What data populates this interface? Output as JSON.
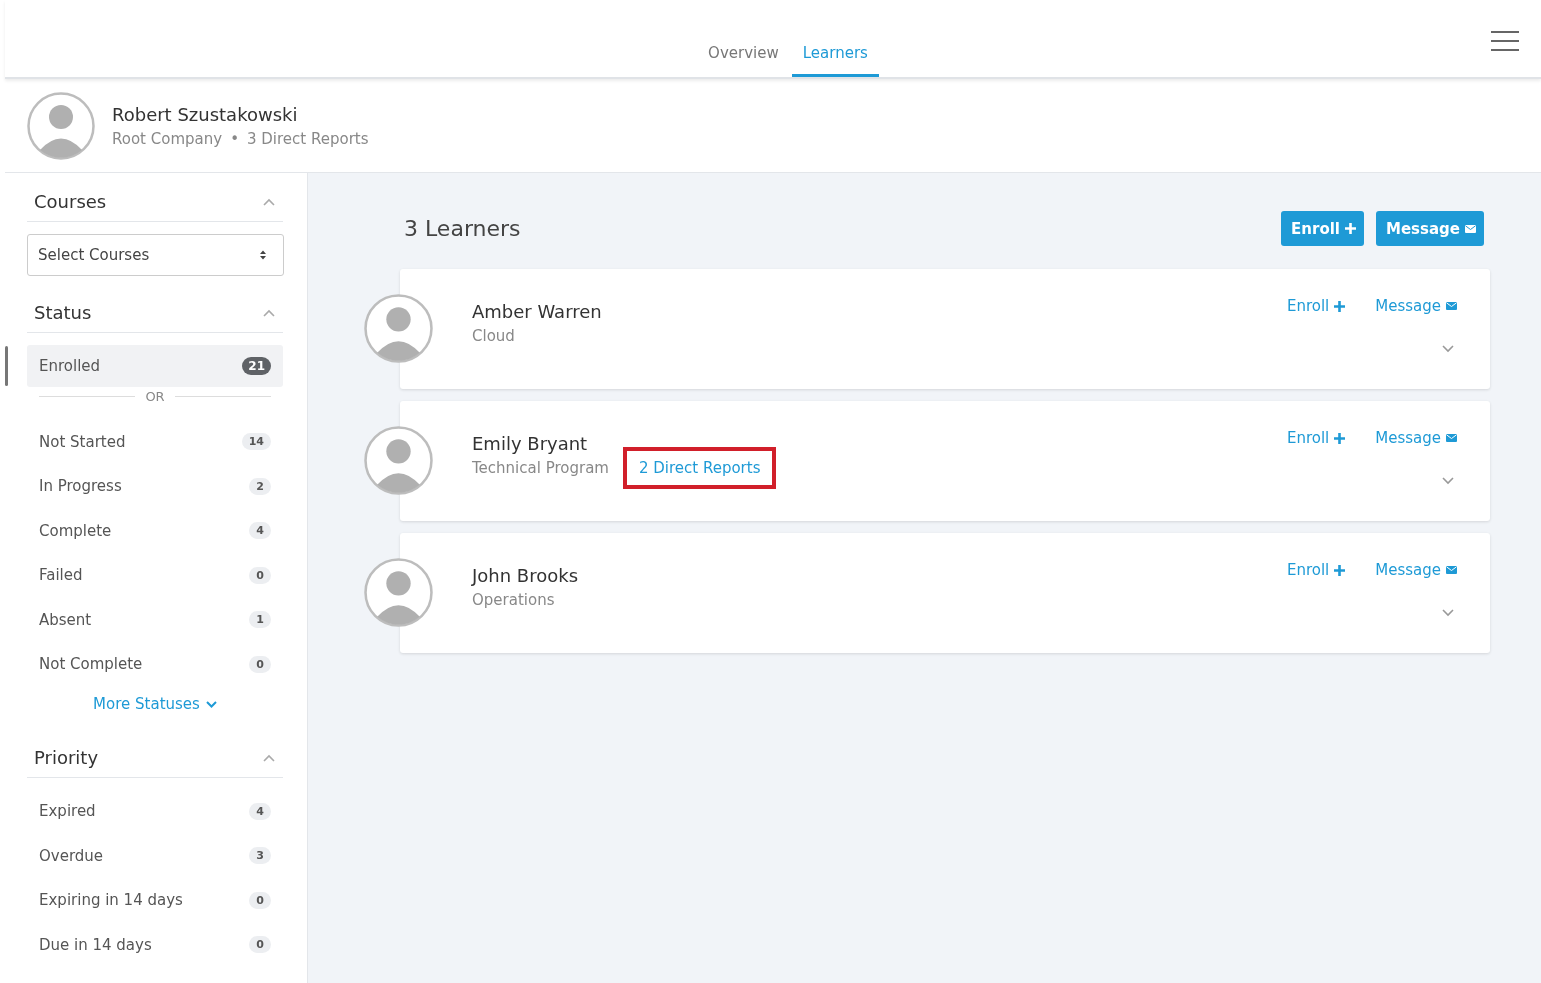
{
  "nav": {
    "tabs": [
      {
        "label": "Overview",
        "selected": false
      },
      {
        "label": "Learners",
        "selected": true
      }
    ]
  },
  "profile": {
    "name": "Robert Szustakowski",
    "company": "Root Company",
    "separator": "•",
    "reports": "3 Direct Reports"
  },
  "sidebar": {
    "courses": {
      "title": "Courses",
      "expanded": true,
      "select": {
        "placeholder": "Select Courses"
      }
    },
    "status": {
      "title": "Status",
      "expanded": true,
      "items": [
        {
          "label": "Enrolled",
          "count": "21",
          "selected": true
        },
        {
          "kind": "divider",
          "label": "OR"
        },
        {
          "label": "Not Started",
          "count": "14",
          "selected": false
        },
        {
          "label": "In Progress",
          "count": "2",
          "selected": false
        },
        {
          "label": "Complete",
          "count": "4",
          "selected": false
        },
        {
          "label": "Failed",
          "count": "0",
          "selected": false
        },
        {
          "label": "Absent",
          "count": "1",
          "selected": false
        },
        {
          "label": "Not Complete",
          "count": "0",
          "selected": false
        }
      ],
      "more": "More Statuses"
    },
    "priority": {
      "title": "Priority",
      "expanded": true,
      "items": [
        {
          "label": "Expired",
          "count": "4",
          "selected": false
        },
        {
          "label": "Overdue",
          "count": "3",
          "selected": false
        },
        {
          "label": "Expiring in 14 days",
          "count": "0",
          "selected": false
        },
        {
          "label": "Due in 14 days",
          "count": "0",
          "selected": false
        }
      ]
    }
  },
  "main": {
    "heading": "3 Learners",
    "buttons": [
      {
        "label": "Enroll",
        "kind": "enroll"
      },
      {
        "label": "Message",
        "kind": "message"
      }
    ],
    "learners": [
      {
        "name": "Amber Warren",
        "team": "Cloud",
        "expanded": false,
        "actions": [
          {
            "label": "Enroll",
            "kind": "enroll"
          },
          {
            "label": "Message",
            "kind": "message"
          }
        ]
      },
      {
        "name": "Emily Bryant",
        "team": "Technical Program",
        "direct_reports": "2 Direct Reports",
        "highlighted": true,
        "expanded": false,
        "actions": [
          {
            "label": "Enroll",
            "kind": "enroll"
          },
          {
            "label": "Message",
            "kind": "message"
          }
        ]
      },
      {
        "name": "John Brooks",
        "team": "Operations",
        "expanded": false,
        "actions": [
          {
            "label": "Enroll",
            "kind": "enroll"
          },
          {
            "label": "Message",
            "kind": "message"
          }
        ]
      }
    ]
  }
}
